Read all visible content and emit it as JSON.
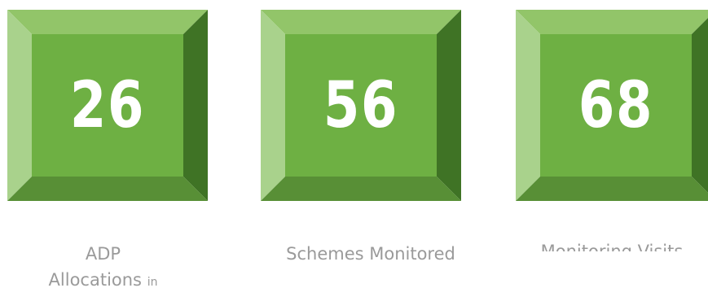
{
  "tiles": [
    {
      "value": "26",
      "caption_line1": "ADP",
      "caption_line2": "Allocations",
      "caption_suffix": "in"
    },
    {
      "value": "56",
      "caption": "Schemes Monitored"
    },
    {
      "value": "68",
      "caption": "Monitoring Visits"
    }
  ],
  "colors": {
    "face": "#6eb043",
    "bevel_top": "#92c569",
    "bevel_left": "#a9d28c",
    "bevel_right": "#3f7325",
    "bevel_bottom": "#588f36",
    "number": "#ffffff",
    "caption": "#9a9a9a"
  }
}
